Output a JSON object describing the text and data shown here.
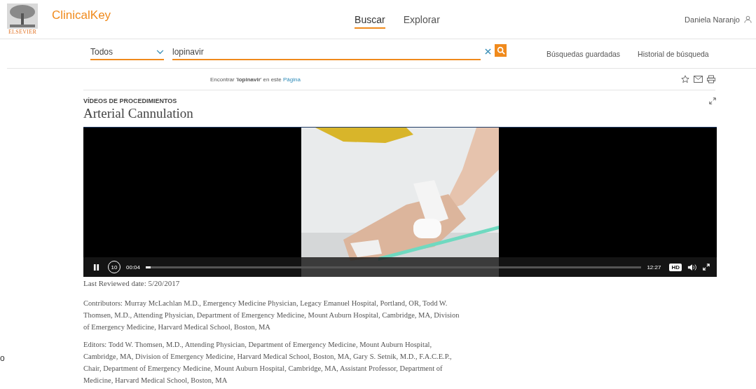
{
  "header": {
    "brand": "ClinicalKey",
    "publisher": "ELSEVIER",
    "nav": [
      {
        "label": "Buscar",
        "selected": true
      },
      {
        "label": "Explorar",
        "selected": false
      }
    ],
    "user": "Daniela Naranjo"
  },
  "search": {
    "scope": "Todos",
    "value": "lopinavir",
    "links": [
      "Búsquedas guardadas",
      "Historial de búsqueda"
    ]
  },
  "find_bar": {
    "text": "Encontrar '**lopinavir**' en este",
    "link": "Página"
  },
  "article": {
    "category": "VÍDEOS DE PROCEDIMIENTOS",
    "title": "Arterial Cannulation",
    "video": {
      "elapsed": "00:04",
      "duration": "12:27",
      "quality": "HD",
      "playing": true,
      "level": 0.01,
      "skip": "10"
    },
    "reviewed": "Last Reviewed date: 5/20/2017",
    "paragraphs": [
      "Contributors: Murray McLachlan M.D., Emergency Medicine Physician, Legacy Emanuel Hospital, Portland, OR, Todd W. Thomsen, M.D., Attending Physician, Department of Emergency Medicine, Mount Auburn Hospital, Cambridge, MA, Division of Emergency Medicine, Harvard Medical School, Boston, MA",
      "Editors: Todd W. Thomsen, M.D., Attending Physician, Department of Emergency Medicine, Mount Auburn Hospital, Cambridge, MA, Division of Emergency Medicine, Harvard Medical School, Boston, MA, Gary S. Setnik, M.D., F.A.C.E.P., Chair, Department of Emergency Medicine, Mount Auburn Hospital, Cambridge, MA, Assistant Professor, Department of Medicine, Harvard Medical School, Boston, MA"
    ]
  },
  "stray_text": "o"
}
